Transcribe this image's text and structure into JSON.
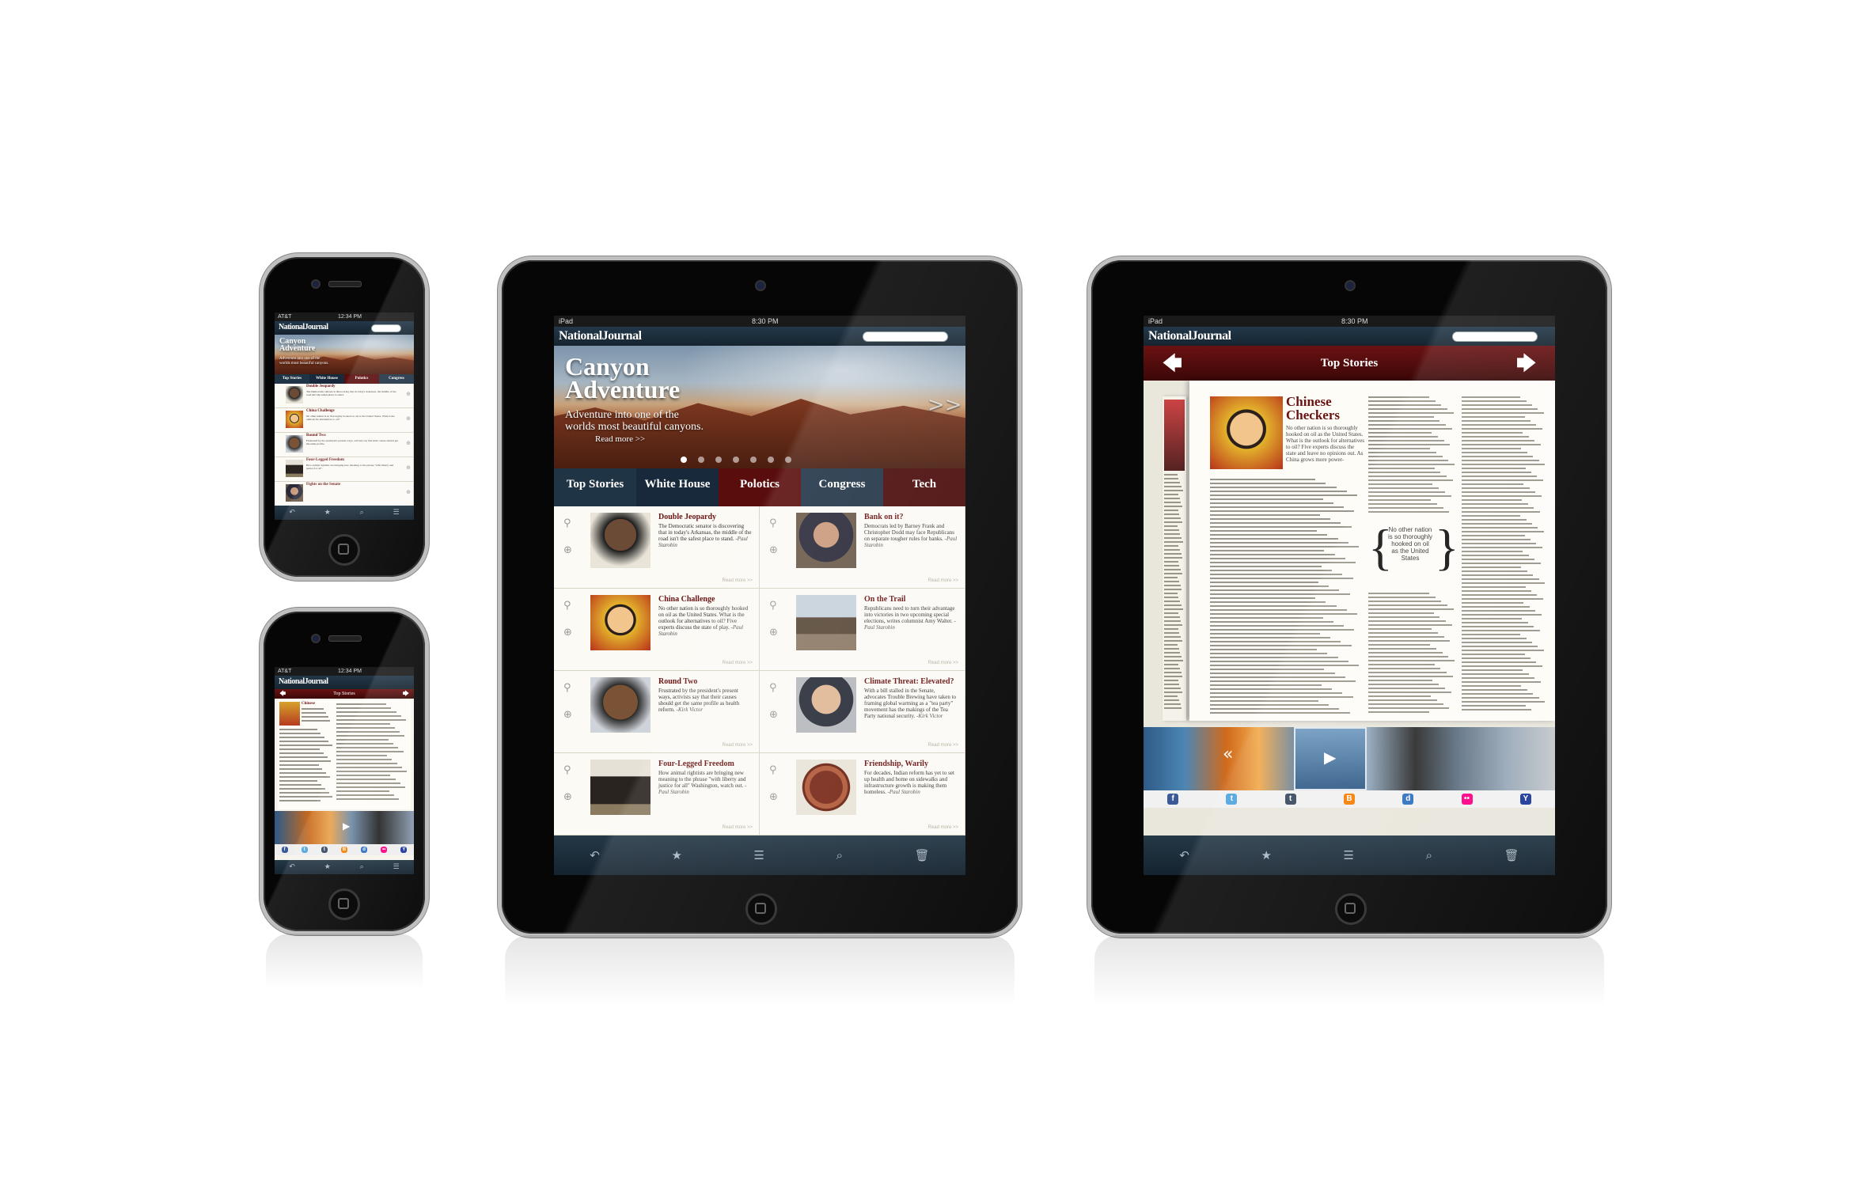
{
  "app": {
    "logo": "NationalJournal"
  },
  "status": {
    "phone_carrier": "AT&T",
    "phone_time": "12:34 PM",
    "ipad_device": "iPad",
    "ipad_time": "8:30 PM"
  },
  "hero": {
    "title_line1": "Canyon",
    "title_line2": "Adventure",
    "subtitle_line1": "Adventure into one of the",
    "subtitle_line2": "worlds most beautiful canyons.",
    "read_more": "Read more >>",
    "next_arrow": ">>",
    "page_count": 7,
    "current_page": 1
  },
  "tabs": [
    {
      "label": "Top Stories",
      "color": "#1f3444"
    },
    {
      "label": "White House",
      "color": "#17293a"
    },
    {
      "label": "Polotics",
      "color": "#5a0d0d"
    },
    {
      "label": "Congress",
      "color": "#213547"
    },
    {
      "label": "Tech",
      "color": "#4b0c0c"
    }
  ],
  "phone_tabs": [
    "Top Stories",
    "White House",
    "Polotics",
    "Congress"
  ],
  "stories": [
    {
      "title": "Double Jeopardy",
      "body": "The Democratic senator is discovering that in today's Arkansas, the middle of the road isn't the safest place to stand.",
      "byline": "-Paul Starobin",
      "read_more": "Read more >>",
      "thumb": "man-portrait"
    },
    {
      "title": "Bank on it?",
      "body": "Democrats led by Barney Frank and Christopher Dodd may face Republicans on separate tougher rules for banks.",
      "byline": "-Paul Starobin",
      "read_more": "Read more >>",
      "thumb": "congressman-portrait"
    },
    {
      "title": "China Challenge",
      "body": "No other nation is so thoroughly hooked on oil as the United States. What is the outlook for alternatives to oil? Five experts discuss the state of play.",
      "byline": "-Paul Starobin",
      "read_more": "Read more >>",
      "thumb": "mao-portrait"
    },
    {
      "title": "On the Trail",
      "body": "Republicans need to turn their advantage into victories in two upcoming special elections, writes columnist Amy Walter.",
      "byline": "-Paul Starobin",
      "read_more": "Read more >>",
      "thumb": "soldiers-statue"
    },
    {
      "title": "Round Two",
      "body": "Frustrated by the president's present ways, activists say that their causes should get the same profile as health reform.",
      "byline": "-Kirk Victor",
      "read_more": "Read more >>",
      "thumb": "obama-portrait"
    },
    {
      "title": "Climate Threat: Elevated?",
      "body": "With a bill stalled in the Senate, advocates Trouble Brewing have taken to framing global warming as a \"tea party\" movement has the makings of the Tea Party national security.",
      "byline": "-Kirk Victor",
      "read_more": "Read more >>",
      "thumb": "bernanke-portrait"
    },
    {
      "title": "Four-Legged Freedom",
      "body": "How animal rightists are bringing new meaning to the phrase \"with liberty and justice for all\" Washington, watch out.",
      "byline": "-Paul Starobin",
      "read_more": "Read more >>",
      "thumb": "cow"
    },
    {
      "title": "Friendship, Warily",
      "body": "For decades, Indian reform has yet to set up health and home on sidewalks and infrastructure growth is making them homeless.",
      "byline": "-Paul Starobin",
      "read_more": "Read more >>",
      "thumb": "coin"
    }
  ],
  "phone_stories": [
    {
      "title": "Double Jeopardy",
      "body": "The Democratic senator is discovering that in today's Arkansas, the middle of the road isn't the safest place to stand.",
      "byline": "-Paul Starobin"
    },
    {
      "title": "China Challenge",
      "body": "No other nation is so thoroughly hooked on oil as the United States. What is the outlook for alternatives to oil?",
      "byline": "-Paul Starobin"
    },
    {
      "title": "Round Two",
      "body": "Frustrated by the president's present ways, activists say that their causes should get the same profile.",
      "byline": "-Kirk Victor"
    },
    {
      "title": "Four-Legged Freedom",
      "body": "How animal rightists are bringing new meaning to the phrase \"with liberty and justice for all\".",
      "byline": "-Paul Starobin"
    },
    {
      "title": "Fights on the Senate",
      "body": "",
      "byline": ""
    }
  ],
  "article": {
    "section": "Top Stories",
    "title_line1": "Chinese",
    "title_line2": "Checkers",
    "pullquote": "No other nation is so thoroughly hooked on oil as the United States",
    "lead": "No other nation is so thoroughly hooked on oil as the United States. What is the outlook for alternatives to oil? Five experts discuss the state and leave no opinions out. As China grows more power-"
  },
  "toolbar": [
    "reply-icon",
    "star-icon",
    "menu-icon",
    "attach-icon",
    "trash-icon"
  ],
  "glyphs": {
    "reply": "↶",
    "star": "★",
    "menu": "☰",
    "attach": "⌕",
    "trash": "🗑",
    "left_arrow": "🡄",
    "right_arrow": "🡆",
    "clip": "⚲",
    "plus": "⊕",
    "play": "▶",
    "rewind": "«",
    "open_brace": "{",
    "close_brace": "}"
  },
  "share_icons": [
    {
      "name": "facebook",
      "label": "f",
      "color": "#3b5998"
    },
    {
      "name": "twitter",
      "label": "t",
      "color": "#4aa3df"
    },
    {
      "name": "tumblr",
      "label": "t",
      "color": "#35465c"
    },
    {
      "name": "blogger",
      "label": "B",
      "color": "#f57d00"
    },
    {
      "name": "delicious",
      "label": "d",
      "color": "#2f6fbf"
    },
    {
      "name": "flickr",
      "label": "••",
      "color": "#ff0084"
    },
    {
      "name": "yahoo",
      "label": "Y",
      "color": "#1e3a9b"
    }
  ]
}
